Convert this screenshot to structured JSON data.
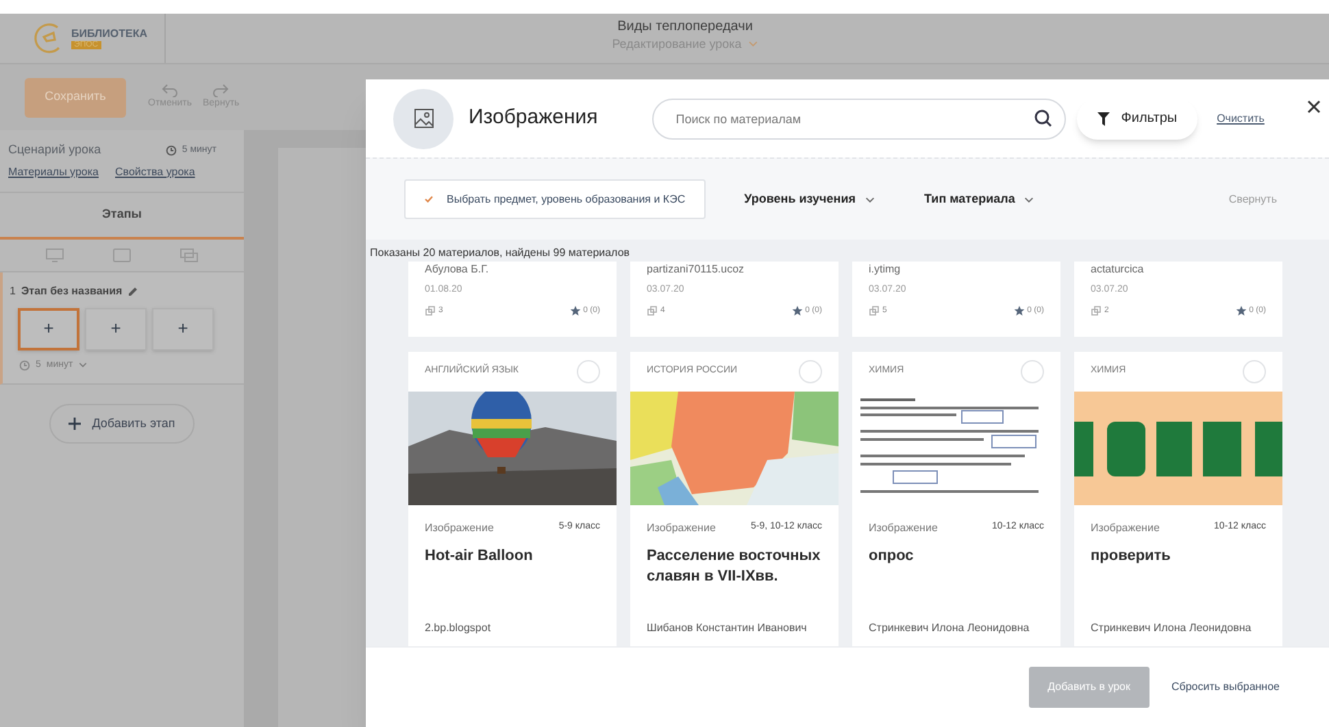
{
  "app": {
    "logo_text": "БИБЛИОТЕКА",
    "logo_badge": "ЭПОС",
    "lesson_title": "Виды теплопередачи",
    "mode": "Редактирование урока",
    "save": "Сохранить",
    "undo": "Отменить",
    "redo": "Вернуть"
  },
  "sidebar": {
    "scenario": "Сценарий урока",
    "duration": "5 минут",
    "links": [
      "Материалы урока",
      "Свойства урока"
    ],
    "tabs": [
      {
        "label": "Этапы",
        "selected": true
      }
    ],
    "stage": {
      "number": "1",
      "name": "Этап без названия",
      "time_value": "5",
      "time_unit": "минут",
      "slots": [
        {
          "label": "+",
          "selected": true
        },
        {
          "label": "+",
          "selected": false
        },
        {
          "label": "+",
          "selected": false
        }
      ]
    },
    "add_stage": "Добавить этап"
  },
  "modal": {
    "title": "Изображения",
    "search_placeholder": "Поиск по материалам",
    "filters": "Фильтры",
    "clear": "Очистить",
    "subject_filter": "Выбрать предмет, уровень образования и КЭС",
    "dropdowns": [
      "Уровень изучения",
      "Тип материала"
    ],
    "collapse": "Свернуть",
    "count": "Показаны 20 материалов, найдены 99 материалов",
    "top_cards": [
      {
        "author": "Абулова Б.Г.",
        "date": "01.08.20",
        "uses": "3",
        "rating": "0 (0)"
      },
      {
        "author": "partizani70115.ucoz",
        "date": "03.07.20",
        "uses": "4",
        "rating": "0 (0)"
      },
      {
        "author": "i.ytimg",
        "date": "03.07.20",
        "uses": "5",
        "rating": "0 (0)"
      },
      {
        "author": "actaturcica",
        "date": "03.07.20",
        "uses": "2",
        "rating": "0 (0)"
      }
    ],
    "cards": [
      {
        "subject": "АНГЛИЙСКИЙ ЯЗЫК",
        "selected": false,
        "kind": "picture",
        "type": "Изображение",
        "grade": "5-9 класс",
        "title": "Hot-air Balloon",
        "author": "2.bp.blogspot"
      },
      {
        "subject": "ИСТОРИЯ РОССИИ",
        "selected": false,
        "kind": "picture",
        "type": "Изображение",
        "grade": "5-9, 10-12 класс",
        "title": "Расселение восточных славян в VII-IXвв.",
        "author": "Шибанов Константин Иванович"
      },
      {
        "subject": "ХИМИЯ",
        "selected": false,
        "kind": "picture",
        "type": "Изображение",
        "grade": "10-12 класс",
        "title": "опрос",
        "author": "Стринкевич Илона Леонидовна"
      },
      {
        "subject": "ХИМИЯ",
        "selected": false,
        "kind": "picture",
        "type": "Изображение",
        "grade": "10-12 класс",
        "title": "проверить",
        "author": "Стринкевич Илона Леонидовна"
      }
    ],
    "add_button": {
      "label": "Добавить в урок",
      "disabled": true
    },
    "reset": "Сбросить выбранное"
  }
}
